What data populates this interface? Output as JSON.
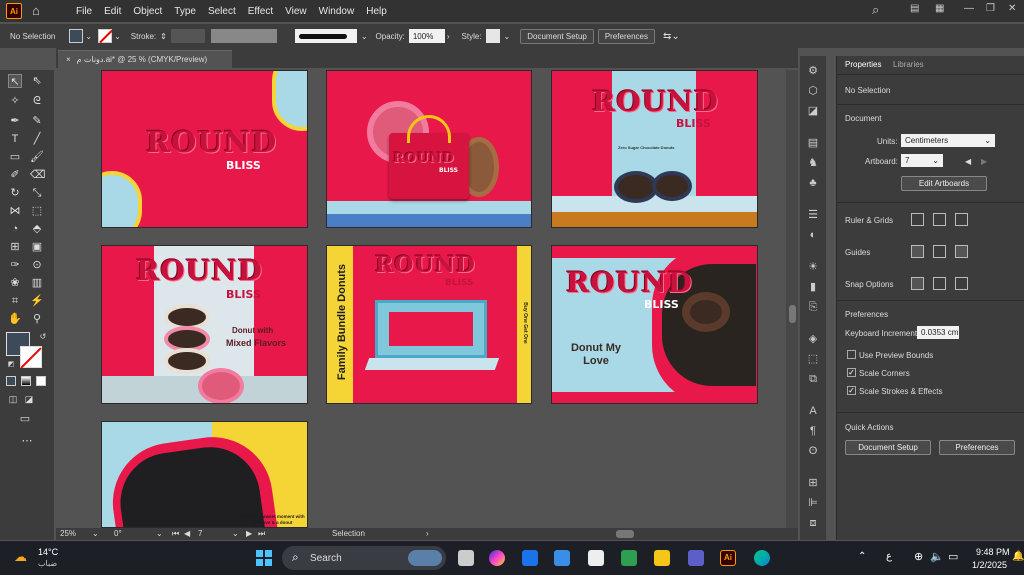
{
  "app": {
    "logo": "Ai",
    "home_icon": "home-icon"
  },
  "menu": [
    "File",
    "Edit",
    "Object",
    "Type",
    "Select",
    "Effect",
    "View",
    "Window",
    "Help"
  ],
  "control": {
    "selection": "No Selection",
    "stroke_label": "Stroke:",
    "opacity_label": "Opacity:",
    "opacity_value": "100%",
    "style_label": "Style:",
    "document_setup": "Document Setup",
    "preferences": "Preferences"
  },
  "tab": {
    "title": "دونات م.ai* @ 25 % (CMYK/Preview)",
    "close": "×"
  },
  "properties": {
    "tabs": [
      "Properties",
      "Libraries"
    ],
    "selection": "No Selection",
    "document_label": "Document",
    "units_label": "Units:",
    "units_value": "Centimeters",
    "artboard_label": "Artboard:",
    "artboard_value": "7",
    "edit_artboards": "Edit Artboards",
    "rulers_grids": "Ruler & Grids",
    "guides": "Guides",
    "snap_options": "Snap Options",
    "preferences_label": "Preferences",
    "keyboard_increment_label": "Keyboard Increment:",
    "keyboard_increment_value": "0.0353 cm",
    "use_preview_bounds": "Use Preview Bounds",
    "scale_corners": "Scale Corners",
    "scale_strokes": "Scale Strokes & Effects",
    "quick_actions": "Quick Actions",
    "qa_document_setup": "Document Setup",
    "qa_preferences": "Preferences"
  },
  "checks": {
    "use_preview_bounds": false,
    "scale_corners": true,
    "scale_strokes": true
  },
  "status": {
    "zoom": "25%",
    "rotate": "0°",
    "artboard": "7",
    "mode": "Selection"
  },
  "artboards": {
    "brand": "ROUND",
    "brand_sub": "BLISS",
    "ab3_tagline": "Zero Sugar Chocolate Donuts",
    "ab4_text1": "Donut with",
    "ab4_text2": "Mixed Flavors",
    "ab5_side": "Family Bundle Donuts",
    "ab5_offer": "Buy One Get One",
    "ab6_text": "Donut My Love",
    "ab7_text": "Sharing a sweet moment with my love & a donut"
  },
  "taskbar": {
    "weather_temp": "14°C",
    "weather_desc": "ضباب",
    "search": "Search",
    "lang": "ع",
    "time": "9:48 PM",
    "date": "1/2/2025"
  },
  "colors": {
    "accent": "#e8194a",
    "panel": "#3c3c3c",
    "canvas": "#535353"
  }
}
